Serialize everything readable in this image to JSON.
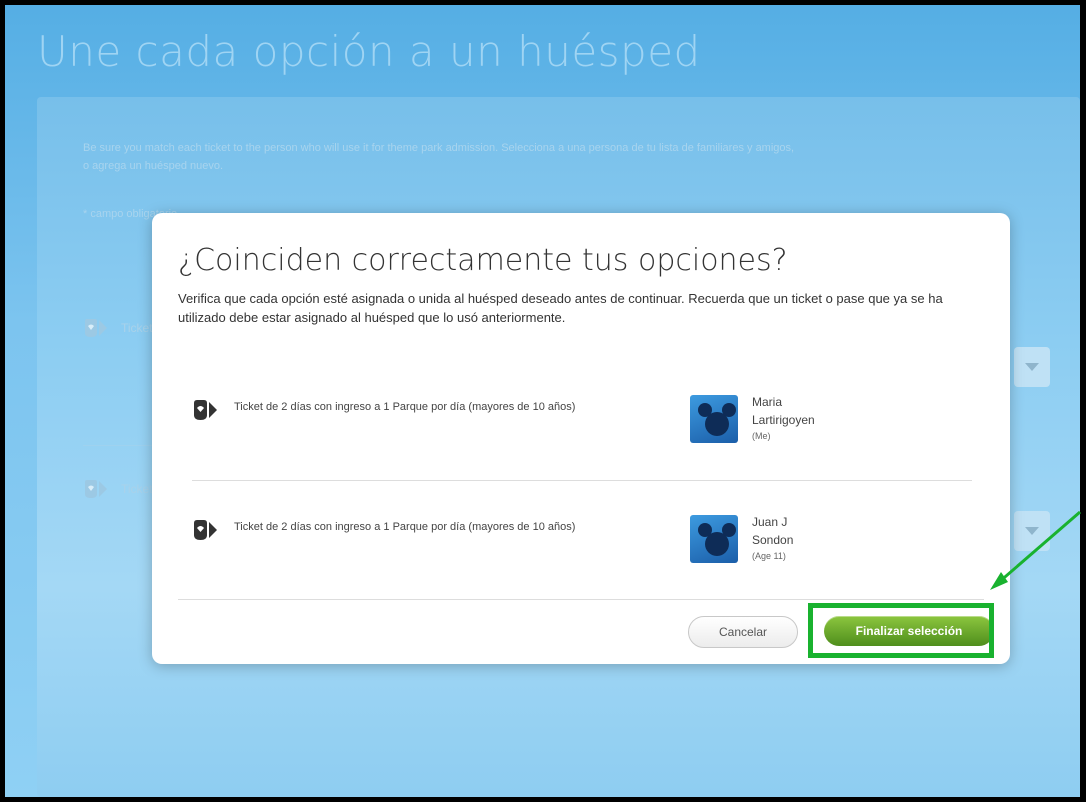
{
  "background": {
    "page_title": "Une cada opción a un huésped",
    "intro": "Be sure you match each ticket to the person who will use it for theme park admission. Selecciona a una persona de tu lista de familiares y amigos, o agrega un huésped nuevo.",
    "required_note": "* campo obligatorio",
    "ticket_label": "Ticket"
  },
  "modal": {
    "title": "¿Coinciden correctamente tus opciones?",
    "description": "Verifica que cada opción esté asignada o unida al huésped deseado antes de continuar. Recuerda que un ticket o pase que ya se ha utilizado debe estar asignado al huésped que lo usó anteriormente.",
    "rows": [
      {
        "ticket": "Ticket de 2 días con ingreso a 1 Parque por día (mayores de 10 años)",
        "first": "Maria",
        "last": "Lartirigoyen",
        "note": "(Me)"
      },
      {
        "ticket": "Ticket de 2 días con ingreso a 1 Parque por día (mayores de 10 años)",
        "first": "Juan J",
        "last": "Sondon",
        "note": "(Age 11)"
      }
    ],
    "cancel_label": "Cancelar",
    "finalize_label": "Finalizar selección"
  },
  "colors": {
    "accent_green": "#19b22f",
    "button_green": "#5a9a24"
  }
}
